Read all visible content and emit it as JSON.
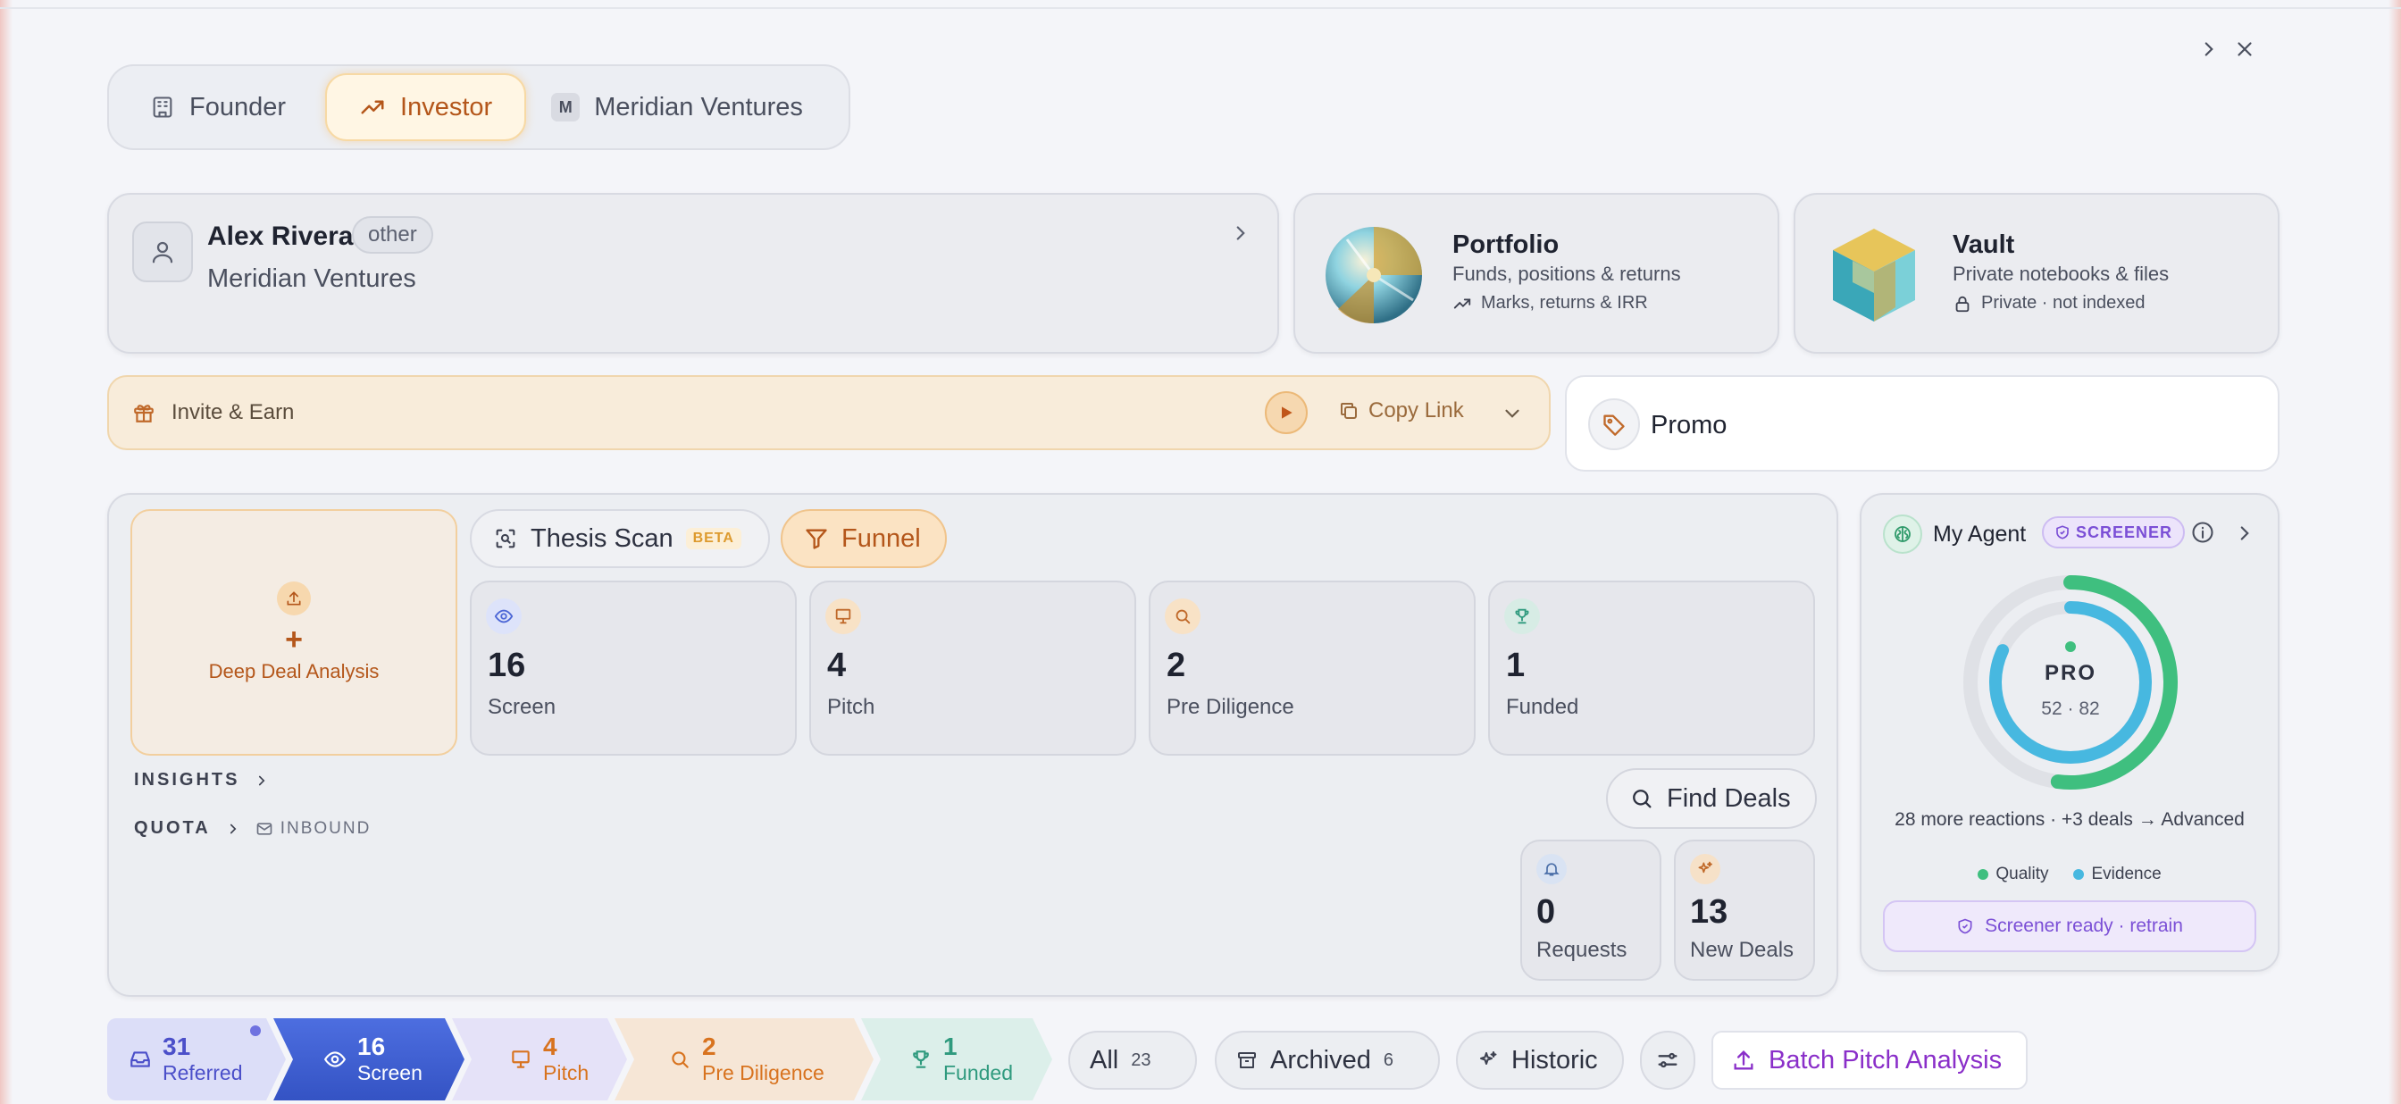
{
  "roles": {
    "founder": "Founder",
    "investor": "Investor",
    "org_badge": "M",
    "org": "Meridian Ventures"
  },
  "profile": {
    "name": "Alex Rivera",
    "tag": "other",
    "org": "Meridian Ventures"
  },
  "portfolio": {
    "title": "Portfolio",
    "subtitle": "Funds, positions & returns",
    "meta": "Marks, returns & IRR"
  },
  "vault": {
    "title": "Vault",
    "subtitle": "Private notebooks & files",
    "meta": "Private · not indexed"
  },
  "invite": {
    "label": "Invite & Earn",
    "copy_link": "Copy Link"
  },
  "promo": {
    "label": "Promo"
  },
  "main": {
    "deep_deal": {
      "plus": "+",
      "label": "Deep Deal Analysis"
    },
    "thesis_scan": "Thesis Scan",
    "beta": "BETA",
    "funnel": "Funnel",
    "stats": [
      {
        "value": "16",
        "label": "Screen",
        "icon": "eye-icon"
      },
      {
        "value": "4",
        "label": "Pitch",
        "icon": "presentation-icon"
      },
      {
        "value": "2",
        "label": "Pre Diligence",
        "icon": "search-icon"
      },
      {
        "value": "1",
        "label": "Funded",
        "icon": "trophy-icon"
      }
    ],
    "insights": "INSIGHTS",
    "quota": "QUOTA",
    "inbound": "INBOUND",
    "find_deals": "Find Deals",
    "requests": {
      "value": "0",
      "label": "Requests"
    },
    "new_deals": {
      "value": "13",
      "label": "New Deals"
    }
  },
  "agent": {
    "title": "My Agent",
    "badge": "SCREENER",
    "level": "PRO",
    "scores": "52 · 82",
    "quality": 52,
    "evidence": 82,
    "note": "28 more reactions · +3 deals → Advanced",
    "legend_quality": "Quality",
    "legend_evidence": "Evidence",
    "retrain": "Screener ready · retrain",
    "colors": {
      "quality": "#3fbf7f",
      "evidence": "#47b8e0"
    }
  },
  "pipeline": {
    "referred": {
      "value": "31",
      "label": "Referred"
    },
    "screen": {
      "value": "16",
      "label": "Screen"
    },
    "pitch": {
      "value": "4",
      "label": "Pitch"
    },
    "pre_diligence": {
      "value": "2",
      "label": "Pre Diligence"
    },
    "funded": {
      "value": "1",
      "label": "Funded"
    }
  },
  "filters": {
    "all": "All",
    "all_count": "23",
    "archived": "Archived",
    "archived_count": "6",
    "historic": "Historic",
    "batch": "Batch Pitch Analysis"
  }
}
